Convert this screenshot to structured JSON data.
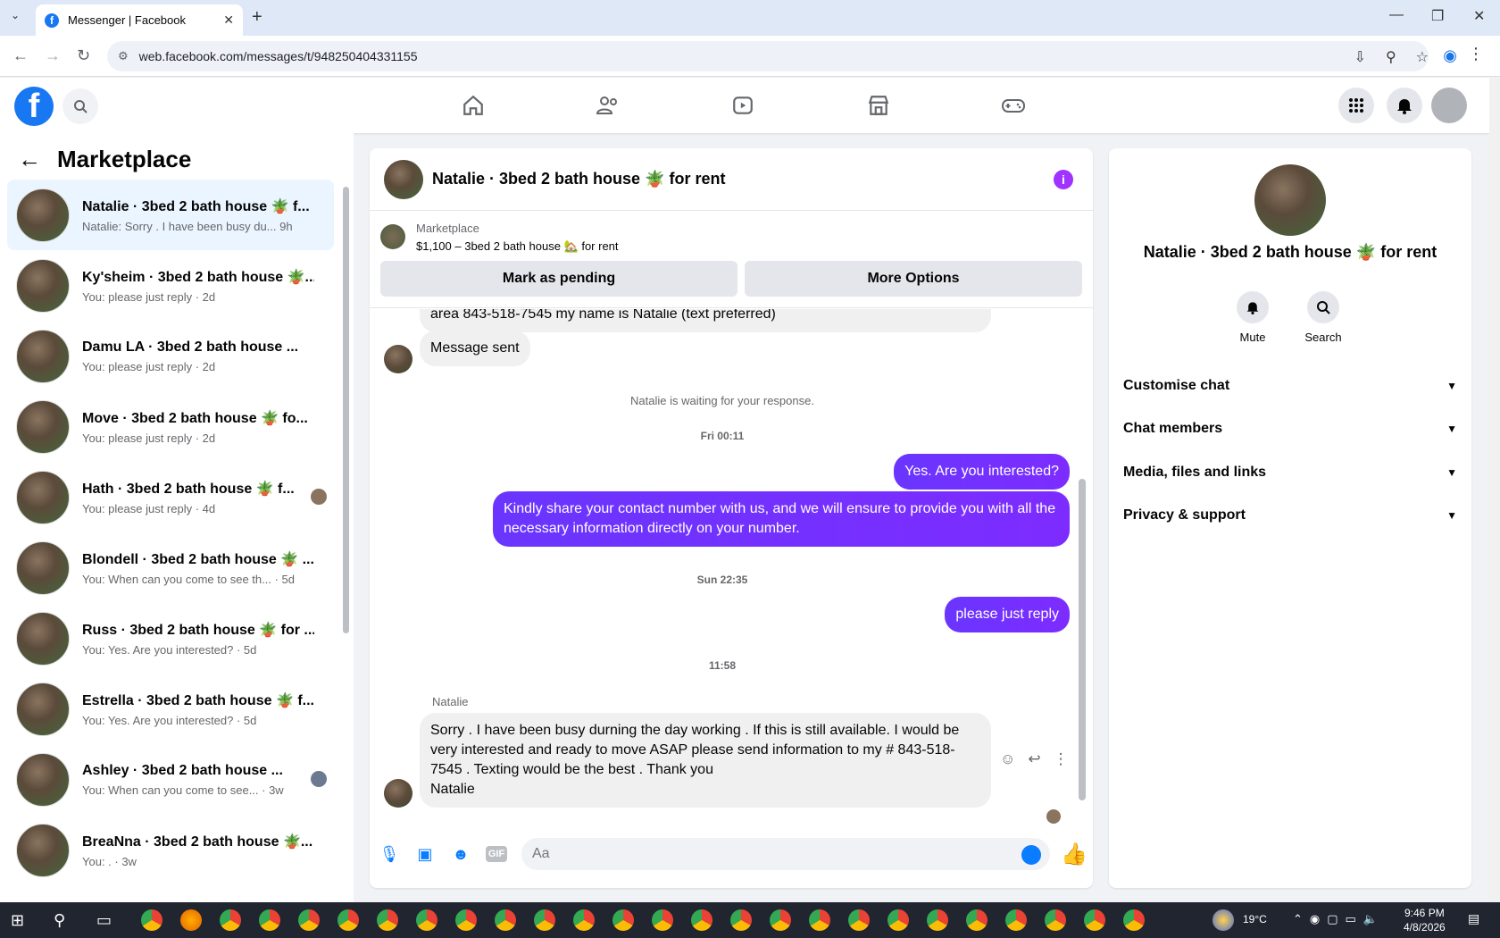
{
  "browser": {
    "tab_title": "Messenger | Facebook",
    "url": "web.facebook.com/messages/t/948250404331155"
  },
  "left": {
    "title": "Marketplace",
    "conversations": [
      {
        "name": "Natalie · 3bed 2 bath house 🪴 f...",
        "preview": "Natalie: Sorry . I have been busy du...  9h"
      },
      {
        "name": "Ky'sheim · 3bed 2 bath house 🪴...",
        "preview": "You: please just reply · 2d"
      },
      {
        "name": "Damu LA · 3bed 2 bath house ...",
        "preview": "You: please just reply · 2d"
      },
      {
        "name": "Move · 3bed 2 bath house 🪴 fo...",
        "preview": "You: please just reply · 2d"
      },
      {
        "name": "Hath · 3bed 2 bath house 🪴 f...",
        "preview": "You: please just reply · 4d"
      },
      {
        "name": "Blondell · 3bed 2 bath house 🪴 ...",
        "preview": "You: When can you come to see th...  · 5d"
      },
      {
        "name": "Russ · 3bed 2 bath house 🪴 for ...",
        "preview": "You: Yes. Are you interested? · 5d"
      },
      {
        "name": "Estrella · 3bed 2 bath house 🪴 f...",
        "preview": "You: Yes. Are you interested? · 5d"
      },
      {
        "name": "Ashley · 3bed 2 bath house ...",
        "preview": "You: When can you come to see... · 3w"
      },
      {
        "name": "BreaNna · 3bed 2 bath house 🪴...",
        "preview": "You: . · 3w"
      }
    ]
  },
  "chat": {
    "title": "Natalie · 3bed 2 bath house 🪴 for rent",
    "marketplace_label": "Marketplace",
    "listing": "$1,100 – 3bed 2 bath house 🏡 for rent",
    "mark_pending": "Mark as pending",
    "more_options": "More Options",
    "partial_msg": "area 843-518-7545 my name is Natalie (text preferred)",
    "msg_sent": "Message sent",
    "waiting": "Natalie is waiting for your response.",
    "ts1": "Fri 00:11",
    "out1": "Yes. Are you interested?",
    "out2": "Kindly share your contact number with us, and we will ensure to provide you with all the necessary information directly on your number.",
    "ts2": "Sun 22:35",
    "out3": "please just reply",
    "ts3": "11:58",
    "sender": "Natalie",
    "in_last": "Sorry . I have been busy durning the day working . If this is still available.  I would be very interested and ready to move ASAP please send information to my # 843-518-7545  . Texting would be the best . Thank you\nNatalie",
    "composer_placeholder": "Aa"
  },
  "right": {
    "name": "Natalie · 3bed 2 bath house 🪴 for rent",
    "mute": "Mute",
    "search": "Search",
    "sections": [
      "Customise chat",
      "Chat members",
      "Media, files and links",
      "Privacy & support"
    ]
  },
  "taskbar": {
    "temp": "19°C",
    "time": "9:46 PM",
    "date": "4/8/2026"
  },
  "colors": {
    "accent": "#7533ff",
    "fb_blue": "#1877f2",
    "messenger_blue": "#0a7cff"
  }
}
